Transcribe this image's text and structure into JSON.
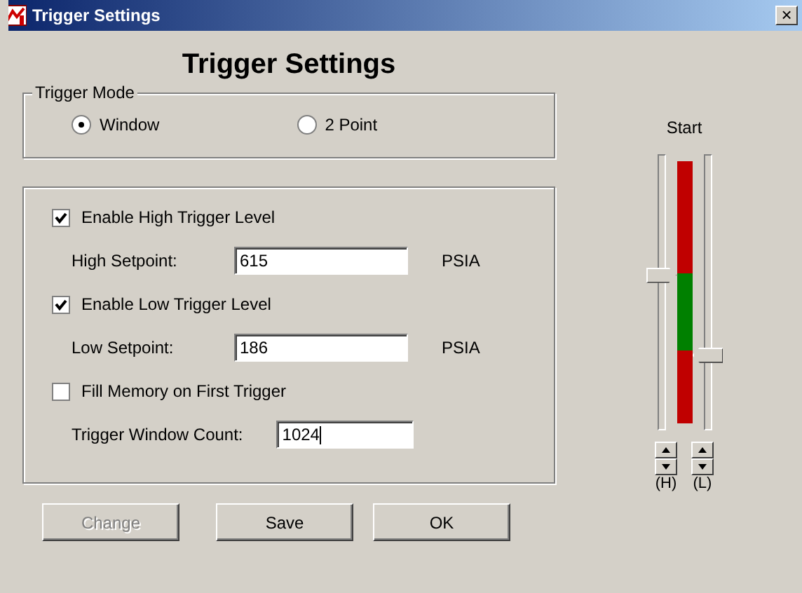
{
  "window": {
    "title": "Trigger Settings",
    "close": "×"
  },
  "heading": "Trigger Settings",
  "trigger_mode": {
    "label": "Trigger Mode",
    "options": [
      {
        "label": "Window",
        "selected": true
      },
      {
        "label": "2 Point",
        "selected": false
      }
    ]
  },
  "settings": [
    {
      "kind": "checkbox",
      "label": "Enable High Trigger Level",
      "checked": true
    },
    {
      "kind": "field",
      "label": "High Setpoint:",
      "value": "615",
      "unit": "PSIA"
    },
    {
      "kind": "checkbox",
      "label": "Enable Low Trigger Level",
      "checked": true
    },
    {
      "kind": "field",
      "label": "Low Setpoint:",
      "value": "186",
      "unit": "PSIA"
    },
    {
      "kind": "checkbox",
      "label": "Fill Memory on First Trigger",
      "checked": false
    },
    {
      "kind": "field",
      "label": "Trigger Window Count:",
      "value": "1024",
      "focused": true
    }
  ],
  "buttons": [
    {
      "label": "Change",
      "disabled": true
    },
    {
      "label": "Save",
      "disabled": false
    },
    {
      "label": "OK",
      "disabled": false
    }
  ],
  "start_label": "Start",
  "sliders": [
    {
      "label": "(H)",
      "level": 0.57
    },
    {
      "label": "(L)",
      "level": 0.28
    }
  ]
}
